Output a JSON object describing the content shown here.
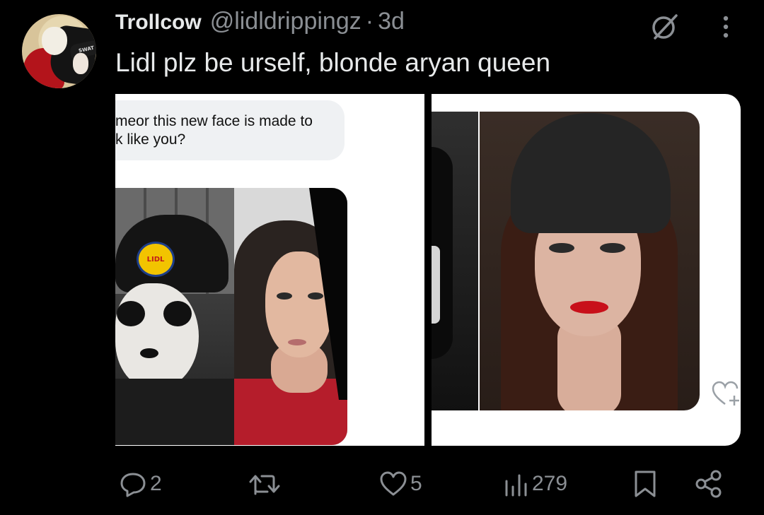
{
  "tweet": {
    "display_name": "Trollcow",
    "handle": "@lidldrippingz",
    "separator": "·",
    "timestamp": "3d",
    "text": "Lidl plz be urself, blonde aryan queen",
    "avatar_hat_text": "SWAT"
  },
  "media": {
    "left": {
      "chat_line1": "meor this new face is made to",
      "chat_line2": "k like you?",
      "logo_text": "LIDL"
    }
  },
  "actions": {
    "reply_count": "2",
    "retweet_count": "",
    "like_count": "5",
    "views_count": "279"
  },
  "icons": {
    "grok": "grok-icon",
    "more": "more-vertical-icon",
    "reply": "reply-icon",
    "retweet": "retweet-icon",
    "like": "heart-icon",
    "views": "views-icon",
    "bookmark": "bookmark-icon",
    "share": "share-icon",
    "heart_plus": "heart-plus-icon"
  },
  "colors": {
    "background": "#000000",
    "text": "#e7e9ea",
    "secondary": "#8b8f94"
  }
}
